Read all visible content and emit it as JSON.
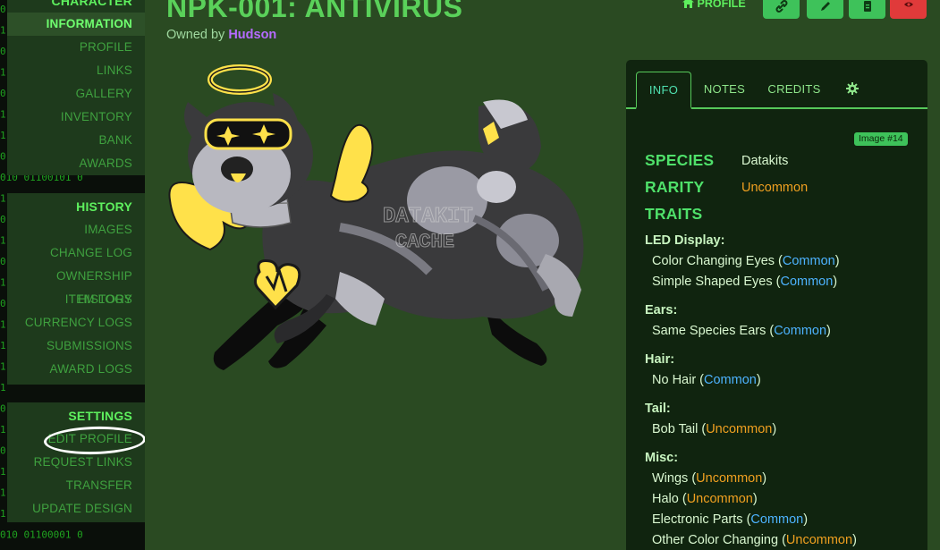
{
  "sidebar": {
    "character_head": "CHARACTER",
    "character_items": [
      "INFORMATION",
      "PROFILE",
      "LINKS",
      "GALLERY",
      "INVENTORY",
      "BANK",
      "AWARDS"
    ],
    "history_head": "HISTORY",
    "history_items": [
      "IMAGES",
      "CHANGE LOG",
      "OWNERSHIP HISTORY",
      "ITEM LOGS",
      "CURRENCY LOGS",
      "SUBMISSIONS",
      "AWARD LOGS"
    ],
    "settings_head": "SETTINGS",
    "settings_items": [
      "EDIT PROFILE",
      "REQUEST LINKS",
      "TRANSFER",
      "UPDATE DESIGN"
    ],
    "matrix_rows": [
      "0110",
      "1",
      "0",
      "1",
      "0",
      "1",
      "1",
      "0",
      "010 01100101 0",
      "1",
      "0",
      "1",
      "0",
      "1",
      "0",
      "1",
      "1",
      "110 01101001 0",
      "1",
      "0",
      "1",
      "0",
      "1",
      "1",
      "1",
      "010 01100001 0"
    ]
  },
  "header": {
    "title": "NPK-001: ANTIVIRUS",
    "owned_by": "Owned by ",
    "owner": "Hudson",
    "profile_link": "PROFILE"
  },
  "artwork": {
    "watermark_top": "DATAKIT",
    "watermark_bottom": "CACHE"
  },
  "panel": {
    "tabs": [
      "INFO",
      "NOTES",
      "CREDITS"
    ],
    "image_badge": "Image #14",
    "species_label": "SPECIES",
    "species_value": "Datakits",
    "rarity_label": "RARITY",
    "rarity_value": "Uncommon",
    "traits_label": "TRAITS",
    "traits": [
      {
        "category": "LED Display:",
        "items": [
          {
            "name": "Color Changing Eyes",
            "rarity": "Common"
          },
          {
            "name": "Simple Shaped Eyes",
            "rarity": "Common"
          }
        ]
      },
      {
        "category": "Ears:",
        "items": [
          {
            "name": "Same Species Ears",
            "rarity": "Common"
          }
        ]
      },
      {
        "category": "Hair:",
        "items": [
          {
            "name": "No Hair",
            "rarity": "Common"
          }
        ]
      },
      {
        "category": "Tail:",
        "items": [
          {
            "name": "Bob Tail",
            "rarity": "Uncommon"
          }
        ]
      },
      {
        "category": "Misc:",
        "items": [
          {
            "name": "Wings",
            "rarity": "Uncommon"
          },
          {
            "name": "Halo",
            "rarity": "Uncommon"
          },
          {
            "name": "Electronic Parts",
            "rarity": "Common"
          },
          {
            "name": "Other Color Changing",
            "rarity": "Uncommon"
          }
        ]
      }
    ]
  },
  "colors": {
    "page_bg": "#2a4a22",
    "accent_green": "#3ec25a",
    "common": "#4db3ff",
    "uncommon": "#f0a020",
    "owner": "#b66bff",
    "danger": "#e03a3a"
  },
  "icons": [
    "home-icon",
    "link-icon",
    "edit-icon",
    "document-icon",
    "delete-icon",
    "gear-icon"
  ]
}
